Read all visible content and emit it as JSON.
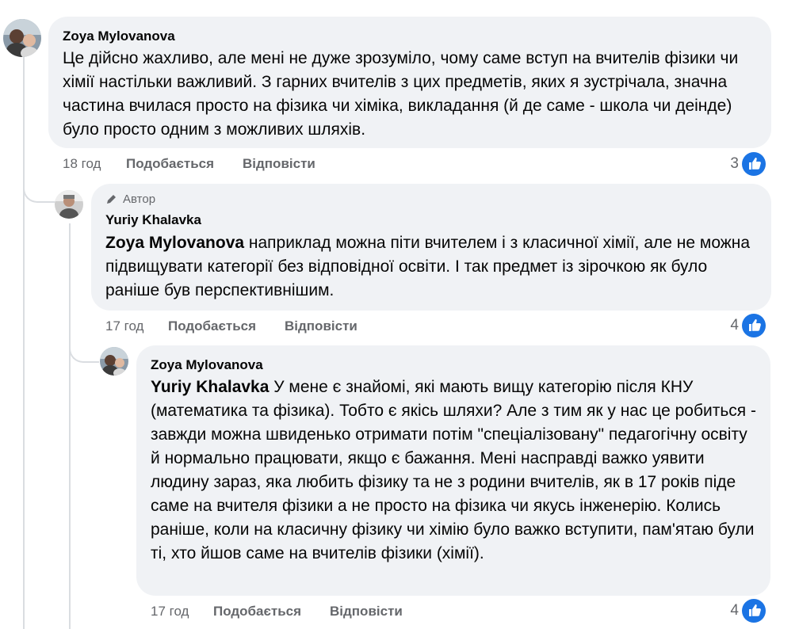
{
  "comments": [
    {
      "author": "Zoya Mylovanova",
      "text": "Це дійсно жахливо, але мені не дуже зрозуміло, чому саме вступ на вчителів фізики чи хімії настільки важливий. З гарних вчителів з цих предметів, яких я зустрічала, значна частина вчилася просто на фізика чи хіміка, викладання (й де саме - школа чи деінде) було просто одним з можливих шляхів.",
      "time": "18 год",
      "like_label": "Подобається",
      "reply_label": "Відповісти",
      "reactions": "3"
    },
    {
      "badge": "Автор",
      "author": "Yuriy Khalavka",
      "mention": "Zoya Mylovanova",
      "text": " наприклад можна піти вчителем і з класичної хімії, але не можна підвищувати категорії без відповідної освіти. І так предмет із зірочкою як було раніше був перспективнішим.",
      "time": "17 год",
      "like_label": "Подобається",
      "reply_label": "Відповісти",
      "reactions": "4"
    },
    {
      "author": "Zoya Mylovanova",
      "mention": "Yuriy Khalavka",
      "text": " У мене є знайомі, які мають вищу категорію після КНУ (математика та фізика). Тобто є якісь шляхи? Але з тим як у нас це робиться - завжди можна швиденько отримати потім \"спеціалізовану\" педагогічну освіту й нормально працювати, якщо є бажання. Мені насправді важко уявити людину зараз, яка любить фізику та не з родини вчителів, як в 17 років піде саме на вчителя фізики а не просто на фізика чи якусь інженерію. Колись раніше, коли на класичну фізику чи хімію було важко вступити, пам'ятаю були ті, хто йшов саме на вчителів фізики (хімії).",
      "time": "17 год",
      "like_label": "Подобається",
      "reply_label": "Відповісти",
      "reactions": "4"
    }
  ],
  "colors": {
    "bubble": "#f0f2f5",
    "meta": "#65676b",
    "like_blue": "#1b74e4",
    "thread_line": "#dadde1"
  },
  "icons": {
    "like": "thumbs-up-icon",
    "author_badge": "pencil-icon"
  }
}
